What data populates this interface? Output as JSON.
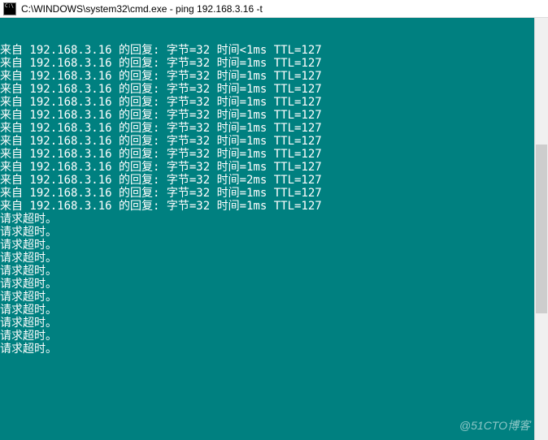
{
  "title_bar": {
    "icon_label": "cmd-icon",
    "text": "C:\\WINDOWS\\system32\\cmd.exe - ping  192.168.3.16 -t"
  },
  "terminal": {
    "replies": [
      {
        "ip": "192.168.3.16",
        "bytes": "32",
        "time_op": "<",
        "time": "1ms",
        "ttl": "127"
      },
      {
        "ip": "192.168.3.16",
        "bytes": "32",
        "time_op": "=",
        "time": "1ms",
        "ttl": "127"
      },
      {
        "ip": "192.168.3.16",
        "bytes": "32",
        "time_op": "=",
        "time": "1ms",
        "ttl": "127"
      },
      {
        "ip": "192.168.3.16",
        "bytes": "32",
        "time_op": "=",
        "time": "1ms",
        "ttl": "127"
      },
      {
        "ip": "192.168.3.16",
        "bytes": "32",
        "time_op": "=",
        "time": "1ms",
        "ttl": "127"
      },
      {
        "ip": "192.168.3.16",
        "bytes": "32",
        "time_op": "=",
        "time": "1ms",
        "ttl": "127"
      },
      {
        "ip": "192.168.3.16",
        "bytes": "32",
        "time_op": "=",
        "time": "1ms",
        "ttl": "127"
      },
      {
        "ip": "192.168.3.16",
        "bytes": "32",
        "time_op": "=",
        "time": "1ms",
        "ttl": "127"
      },
      {
        "ip": "192.168.3.16",
        "bytes": "32",
        "time_op": "=",
        "time": "1ms",
        "ttl": "127"
      },
      {
        "ip": "192.168.3.16",
        "bytes": "32",
        "time_op": "=",
        "time": "1ms",
        "ttl": "127"
      },
      {
        "ip": "192.168.3.16",
        "bytes": "32",
        "time_op": "=",
        "time": "2ms",
        "ttl": "127"
      },
      {
        "ip": "192.168.3.16",
        "bytes": "32",
        "time_op": "=",
        "time": "1ms",
        "ttl": "127"
      },
      {
        "ip": "192.168.3.16",
        "bytes": "32",
        "time_op": "=",
        "time": "1ms",
        "ttl": "127"
      }
    ],
    "reply_template": {
      "prefix": "来自 ",
      "middle": " 的回复: 字节=",
      "time_label": " 时间",
      "ttl_label": " TTL="
    },
    "timeouts": [
      "请求超时。",
      "请求超时。",
      "请求超时。",
      "请求超时。",
      "请求超时。",
      "请求超时。",
      "请求超时。",
      "请求超时。",
      "请求超时。",
      "请求超时。",
      "请求超时。"
    ]
  },
  "watermark": "@51CTO博客"
}
